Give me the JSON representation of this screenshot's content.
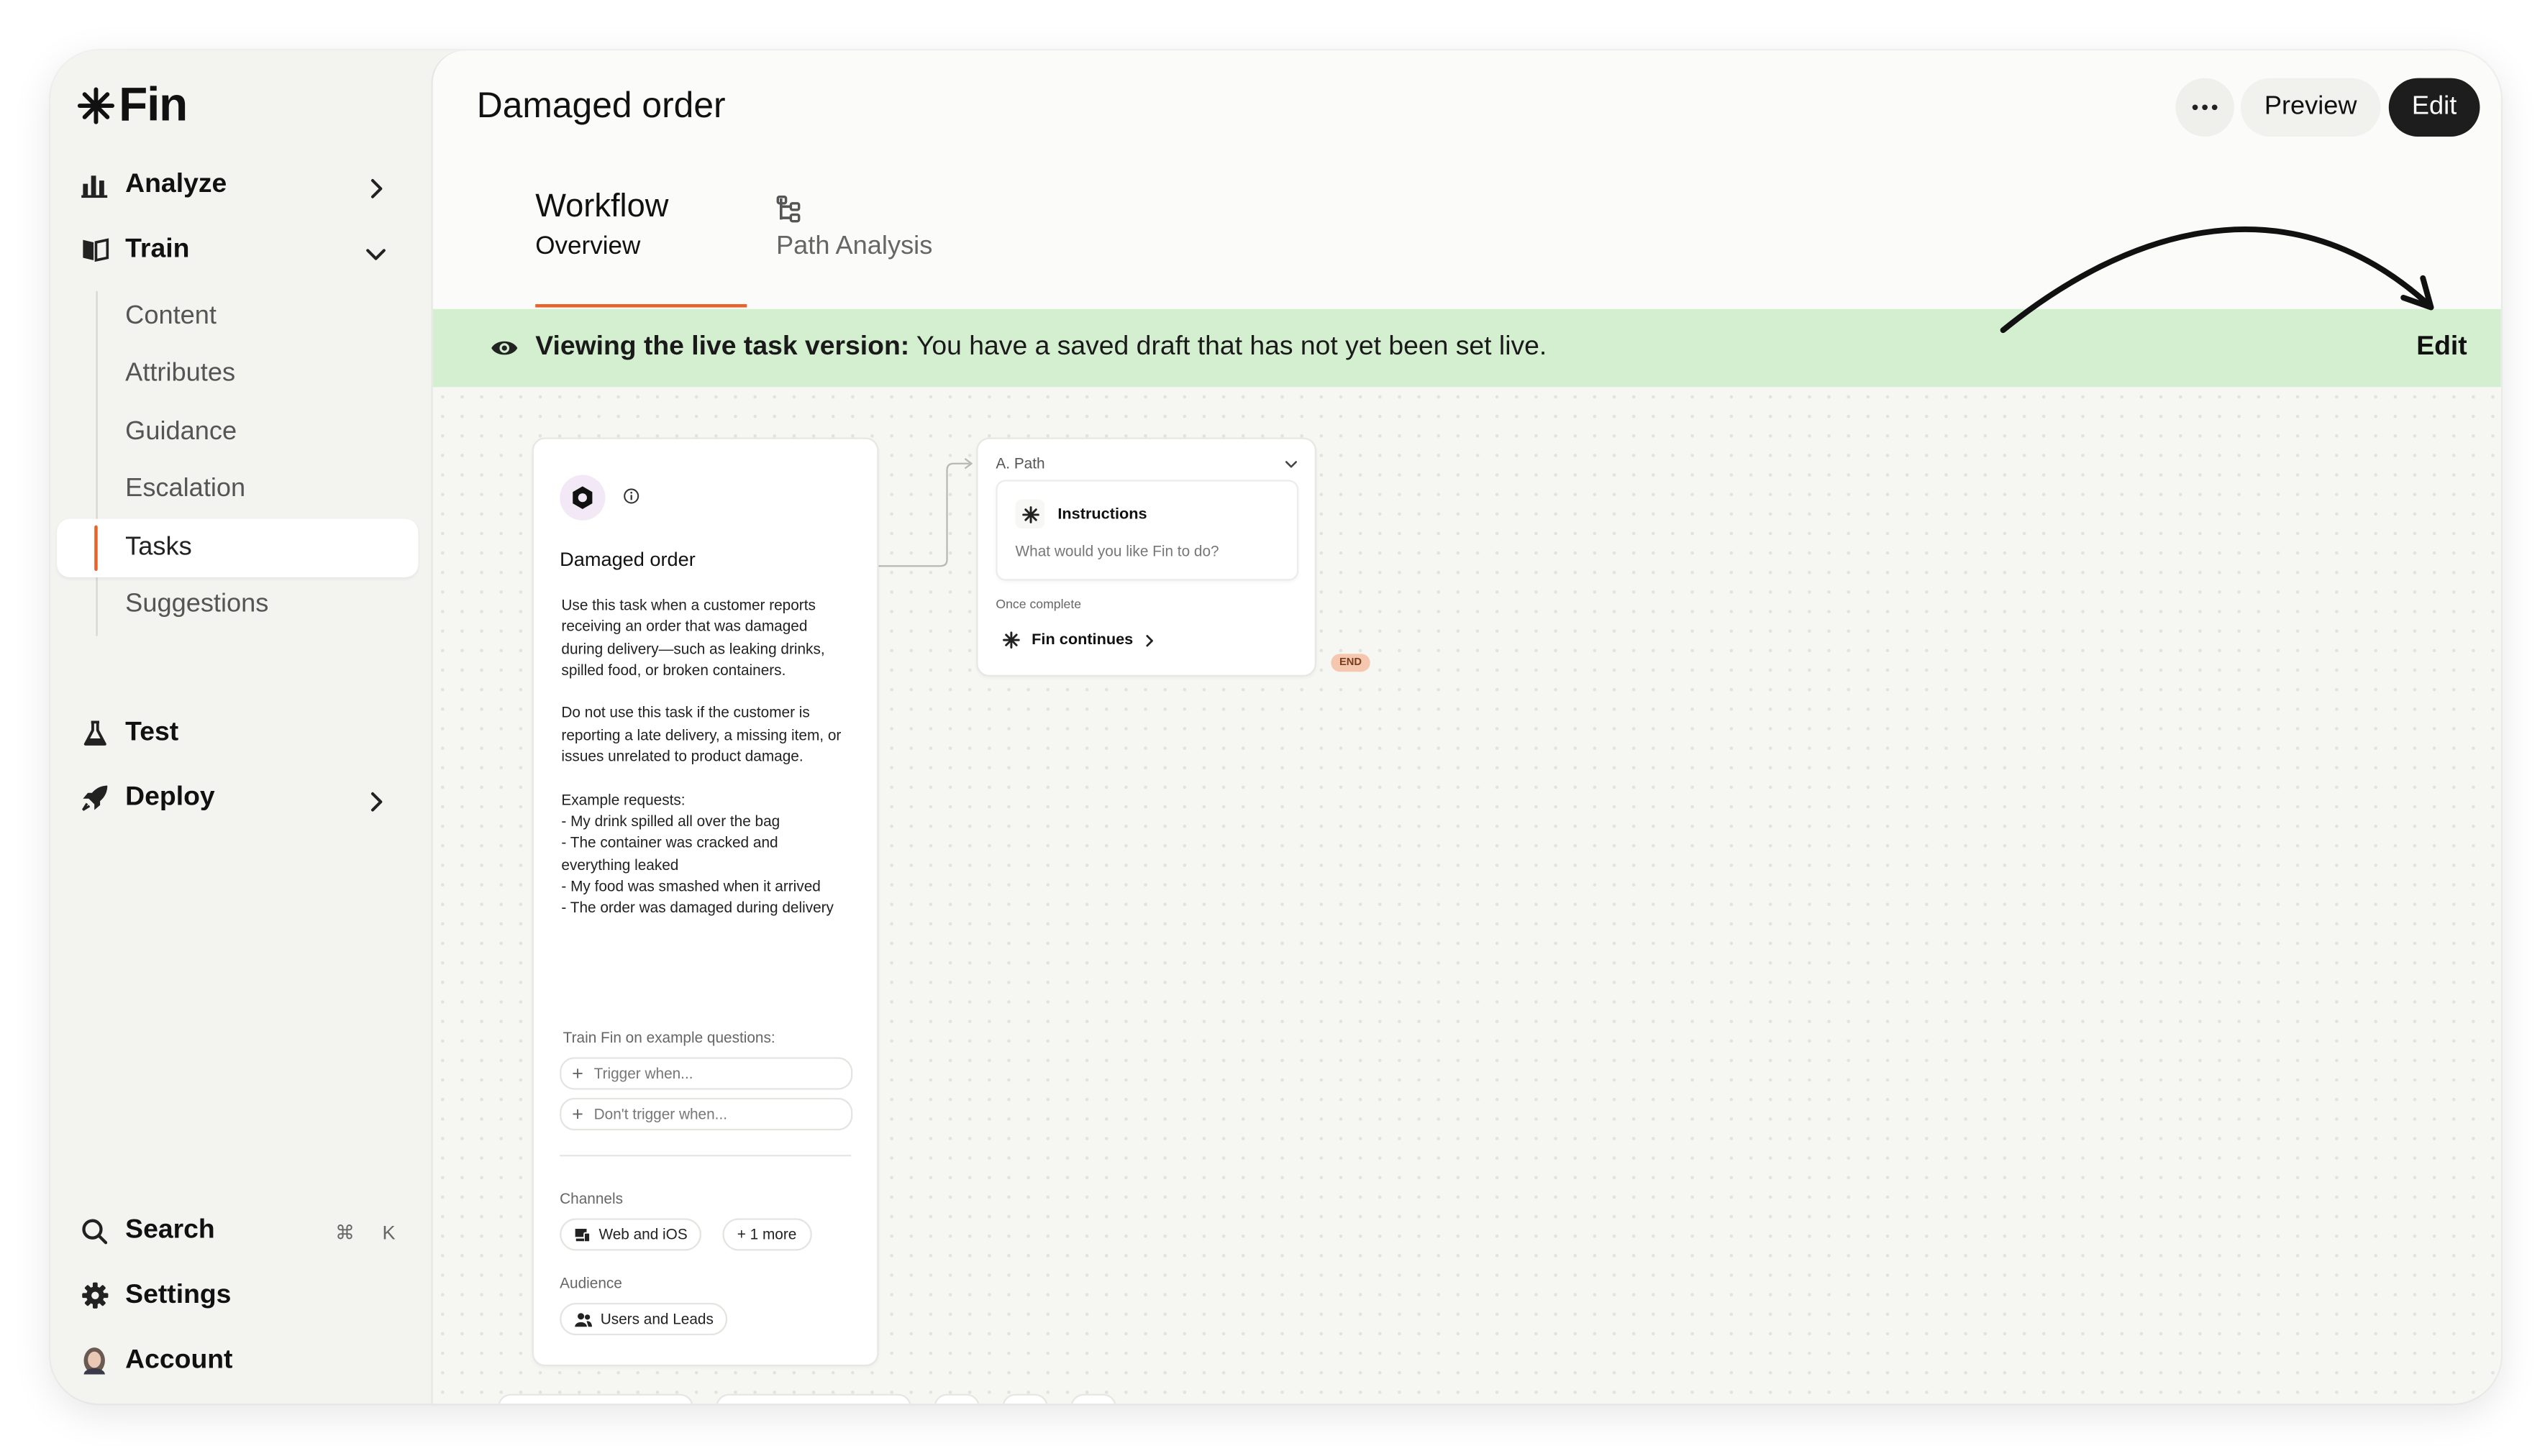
{
  "app": {
    "logo_text": "Fin"
  },
  "sidebar": {
    "items": [
      {
        "label": "Analyze"
      },
      {
        "label": "Train"
      },
      {
        "label": "Test"
      },
      {
        "label": "Deploy"
      }
    ],
    "train_subitems": [
      {
        "label": "Content"
      },
      {
        "label": "Attributes"
      },
      {
        "label": "Guidance"
      },
      {
        "label": "Escalation"
      },
      {
        "label": "Tasks",
        "active": true
      },
      {
        "label": "Suggestions"
      }
    ],
    "bottom": {
      "search_label": "Search",
      "search_shortcut_1": "⌘",
      "search_shortcut_2": "K",
      "settings_label": "Settings",
      "account_label": "Account"
    }
  },
  "header": {
    "title": "Damaged order",
    "more_icon": "ellipsis-icon",
    "preview_label": "Preview",
    "edit_label": "Edit"
  },
  "tabs": [
    {
      "title": "Workflow",
      "subtitle": "Overview",
      "active": true
    },
    {
      "label": "Path Analysis",
      "icon": "tree-icon"
    }
  ],
  "banner": {
    "bold": "Viewing the live task version:",
    "text": " You have a saved draft that has not yet been set live.",
    "edit_label": "Edit",
    "background": "#d3efcf"
  },
  "trigger_card": {
    "title": "Damaged order",
    "description": "Use this task when a customer reports receiving an order that was damaged during delivery—such as leaking drinks, spilled food, or broken containers.\n\nDo not use this task if the customer is reporting a late delivery, a missing item, or issues unrelated to product damage.\n\nExample requests:\n- My drink spilled all over the bag\n- The container was cracked and everything leaked\n- My food was smashed when it arrived\n- The order was damaged during delivery",
    "train_label": "Train Fin on example questions:",
    "trigger_placeholder": "Trigger when...",
    "dont_trigger_placeholder": "Don't trigger when...",
    "channels_label": "Channels",
    "channel_chip": "Web and iOS",
    "more_chip": "+ 1 more",
    "audience_label": "Audience",
    "audience_chip": "Users and Leads"
  },
  "path_card": {
    "label": "A. Path",
    "instructions_title": "Instructions",
    "instructions_placeholder": "What would you like Fin to do?",
    "once_complete": "Once complete",
    "fin_continues": "Fin continues",
    "end_badge": "END"
  },
  "colors": {
    "accent": "#e8622a",
    "sidebar_bg": "#f3f3f0",
    "edit_button_bg": "#1d1d1d"
  }
}
